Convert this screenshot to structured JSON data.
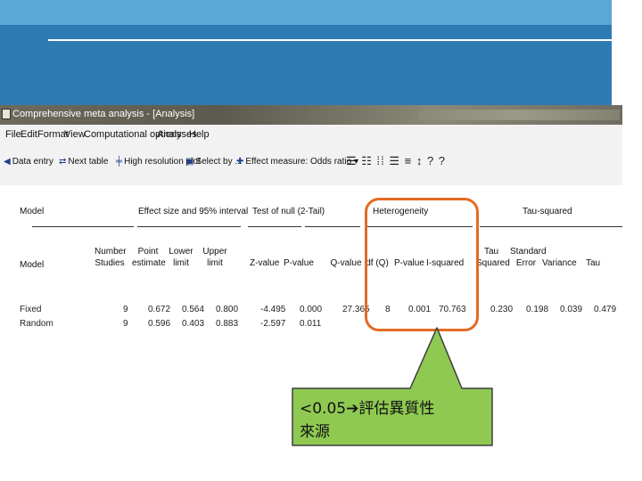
{
  "window": {
    "title": "Comprehensive meta analysis - [Analysis]"
  },
  "menu": [
    "File",
    "Edit",
    "Format",
    "View",
    "Computational options",
    "Analyses",
    "Help"
  ],
  "toolbar": {
    "data_entry": "Data entry",
    "next_table": "Next table",
    "high_res_plot": "High resolution plot",
    "select_by": "Select by ...",
    "effect_measure": "Effect measure: Odds ratio",
    "dropdown_arrow": "▾",
    "icons": "☰ ☷ ⁞⁞ ☰ ≡ ↕ ? ?"
  },
  "table": {
    "group_headers": {
      "model": "Model",
      "effect": "Effect size and 95% interval",
      "test_null": "Test of null (2-Tail)",
      "heterogeneity": "Heterogeneity",
      "tau": "Tau-squared"
    },
    "columns": {
      "model": "Model",
      "number_studies": "Number\nStudies",
      "point_estimate": "Point\nestimate",
      "lower_limit": "Lower\nlimit",
      "upper_limit": "Upper\nlimit",
      "z_value": "Z-value",
      "p_value": "P-value",
      "q_value": "Q-value",
      "df_q": "df (Q)",
      "het_p_value": "P-value",
      "i_squared": "I-squared",
      "tau_squared": "Tau\nSquared",
      "standard_error": "Standard\nError",
      "variance": "Variance",
      "tau": "Tau"
    },
    "rows": [
      {
        "model": "Fixed",
        "number_studies": "9",
        "point_estimate": "0.672",
        "lower_limit": "0.564",
        "upper_limit": "0.800",
        "z_value": "-4.495",
        "p_value": "0.000",
        "q_value": "27.365",
        "df_q": "8",
        "het_p_value": "0.001",
        "i_squared": "70.763",
        "tau_squared": "0.230",
        "standard_error": "0.198",
        "variance": "0.039",
        "tau": "0.479"
      },
      {
        "model": "Random",
        "number_studies": "9",
        "point_estimate": "0.596",
        "lower_limit": "0.403",
        "upper_limit": "0.883",
        "z_value": "-2.597",
        "p_value": "0.011",
        "q_value": "",
        "df_q": "",
        "het_p_value": "",
        "i_squared": "",
        "tau_squared": "",
        "standard_error": "",
        "variance": "",
        "tau": ""
      }
    ]
  },
  "annotation": {
    "line1": "<0.05➔評估異質性",
    "line2": "來源",
    "callout_color": "#8fc952",
    "highlight_color": "#e46a22"
  }
}
